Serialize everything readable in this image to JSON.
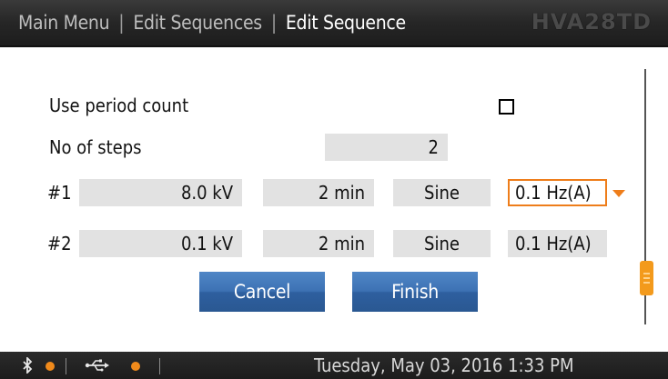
{
  "header": {
    "crumbs": [
      "Main Menu",
      "Edit Sequences",
      "Edit Sequence"
    ],
    "separator": "|",
    "brand": "HVA28TD"
  },
  "settings": {
    "use_period_count_label": "Use period count",
    "use_period_count_checked": false,
    "no_of_steps_label": "No of steps",
    "no_of_steps_value": "2"
  },
  "steps": [
    {
      "label": "#1",
      "voltage": "8.0 kV",
      "duration": "2 min",
      "waveform": "Sine",
      "frequency": "0.1 Hz(A)",
      "selected_field": "frequency"
    },
    {
      "label": "#2",
      "voltage": "0.1 kV",
      "duration": "2 min",
      "waveform": "Sine",
      "frequency": "0.1 Hz(A)"
    }
  ],
  "buttons": {
    "cancel": "Cancel",
    "finish": "Finish"
  },
  "status": {
    "bluetooth_icon": "bluetooth-icon",
    "usb_icon": "usb-icon",
    "indicator_color": "#f08a1b",
    "datetime": "Tuesday, May 03, 2016 1:33 PM"
  },
  "colors": {
    "accent": "#ee7d1a",
    "button": "#3d72b4",
    "field_bg": "#e2e2e2"
  }
}
